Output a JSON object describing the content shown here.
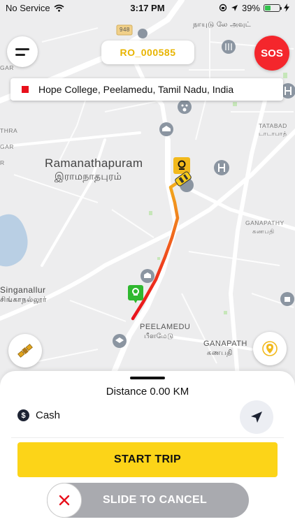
{
  "status_bar": {
    "carrier": "No Service",
    "time": "3:17 PM",
    "battery_percent": "39%",
    "battery_level": 0.39,
    "icons": [
      "wifi-icon",
      "screen-lock-icon",
      "location-arrow-icon",
      "battery-icon",
      "charging-icon"
    ]
  },
  "header": {
    "ride_id": "RO_000585",
    "sos_label": "SOS"
  },
  "destination": {
    "address": "Hope College, Peelamedu, Tamil Nadu, India"
  },
  "map": {
    "road_shield": "948",
    "labels": {
      "ramanathapuram_en": "Ramanathapuram",
      "ramanathapuram_ta": "இராமநாதபுரம்",
      "peelamedu_en": "PEELAMEDU",
      "peelamedu_ta": "பீளமேடு",
      "ganapathy_en": "GANAPATHY",
      "ganapathy_ta": "கணபதி",
      "ganapath_en": "GANAPATH",
      "ganapath_ta": "கணபதி",
      "singanallur_en": "Singanallur",
      "singanallur_ta": "சிங்காநல்லூர்",
      "tatabad_en": "TATABAD",
      "tatabad_ta": "டாடாபாத்",
      "top_tamil": "நாயுடு லே அவுட்",
      "left_gar": "GAR",
      "left_thra": "THRA",
      "left_gar2": "GAR",
      "left_r": "R"
    },
    "route_colors": {
      "start": "#e8101c",
      "middle": "#f0741e",
      "end": "#f2b21c"
    }
  },
  "trip": {
    "distance_text": "Distance 0.00 KM",
    "payment_method": "Cash",
    "payment_icon_glyph": "$",
    "start_trip_label": "START TRIP",
    "slide_cancel_label": "SLIDE TO CANCEL"
  },
  "colors": {
    "accent_yellow": "#fcd418",
    "sos_red": "#f4262c",
    "ride_id_text": "#e8b400",
    "slide_track": "#a9aaaf",
    "cancel_x": "#e8101c"
  }
}
